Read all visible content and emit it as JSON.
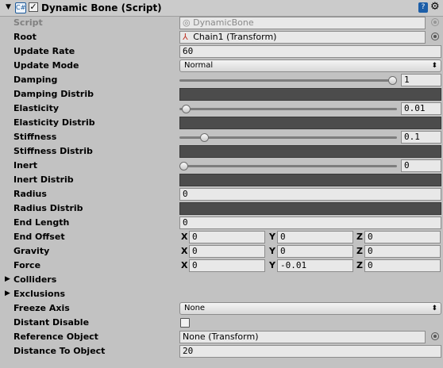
{
  "component": {
    "title": "Dynamic Bone (Script)",
    "enabled": true,
    "help_icon": "help-book-icon",
    "settings_icon": "gear-icon"
  },
  "fields": {
    "script": {
      "label": "Script",
      "value": "DynamicBone"
    },
    "root": {
      "label": "Root",
      "value": "Chain1 (Transform)"
    },
    "update_rate": {
      "label": "Update Rate",
      "value": "60"
    },
    "update_mode": {
      "label": "Update Mode",
      "value": "Normal"
    },
    "damping": {
      "label": "Damping",
      "value": "1",
      "slider_fraction": 1.0
    },
    "damping_distrib": {
      "label": "Damping Distrib"
    },
    "elasticity": {
      "label": "Elasticity",
      "value": "0.01",
      "slider_fraction": 0.01
    },
    "elasticity_distrib": {
      "label": "Elasticity Distrib"
    },
    "stiffness": {
      "label": "Stiffness",
      "value": "0.1",
      "slider_fraction": 0.1
    },
    "stiffness_distrib": {
      "label": "Stiffness Distrib"
    },
    "inert": {
      "label": "Inert",
      "value": "0",
      "slider_fraction": 0.0
    },
    "inert_distrib": {
      "label": "Inert Distrib"
    },
    "radius": {
      "label": "Radius",
      "value": "0"
    },
    "radius_distrib": {
      "label": "Radius Distrib"
    },
    "end_length": {
      "label": "End Length",
      "value": "0"
    },
    "end_offset": {
      "label": "End Offset",
      "x": "0",
      "y": "0",
      "z": "0"
    },
    "gravity": {
      "label": "Gravity",
      "x": "0",
      "y": "0",
      "z": "0"
    },
    "force": {
      "label": "Force",
      "x": "0",
      "y": "-0.01",
      "z": "0"
    },
    "colliders": {
      "label": "Colliders"
    },
    "exclusions": {
      "label": "Exclusions"
    },
    "freeze_axis": {
      "label": "Freeze Axis",
      "value": "None"
    },
    "distant_disable": {
      "label": "Distant Disable",
      "checked": false
    },
    "reference_object": {
      "label": "Reference Object",
      "value": "None (Transform)"
    },
    "distance_to_object": {
      "label": "Distance To Object",
      "value": "20"
    }
  },
  "axis_labels": {
    "x": "X",
    "y": "Y",
    "z": "Z"
  },
  "colors": {
    "panel_bg": "#c2c2c2",
    "curve_field_bg": "#4c4c4c",
    "field_bg": "#e8e8e8"
  }
}
